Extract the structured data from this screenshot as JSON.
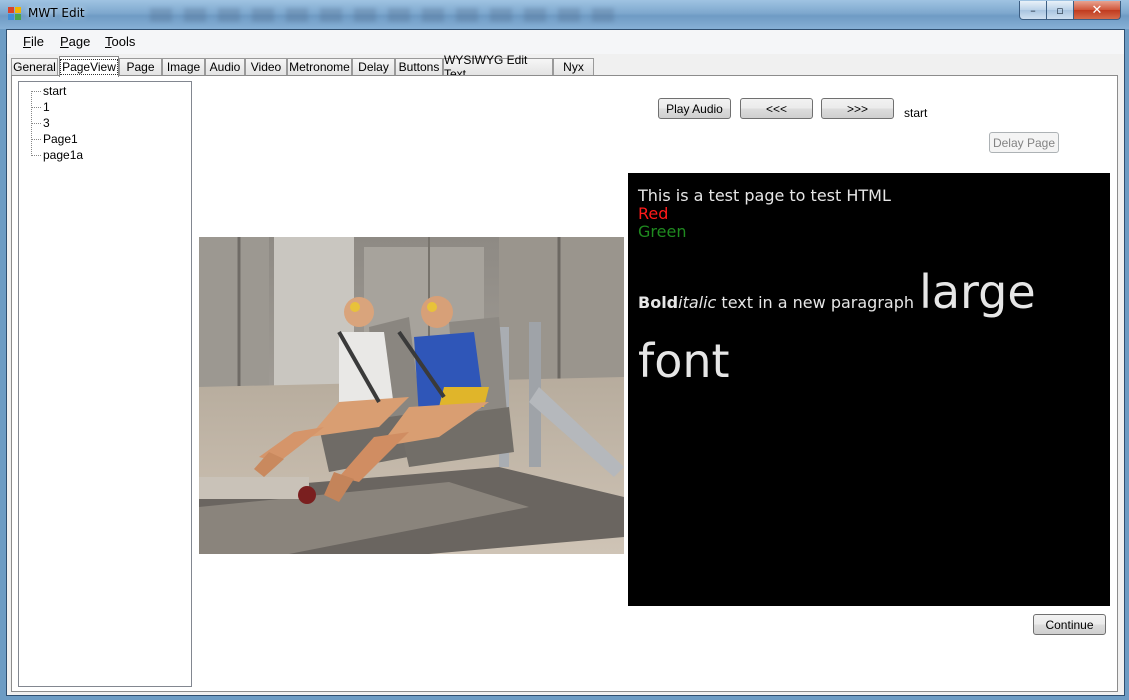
{
  "window": {
    "title": "MWT Edit",
    "buttons": {
      "minimize": "–",
      "maximize": "▫",
      "close": "✕"
    }
  },
  "menu": [
    {
      "label": "File",
      "hotkey": "F",
      "rest": "ile"
    },
    {
      "label": "Page",
      "hotkey": "P",
      "rest": "age"
    },
    {
      "label": "Tools",
      "hotkey": "T",
      "rest": "ools"
    }
  ],
  "tabs": [
    "General",
    "PageView",
    "Page",
    "Image",
    "Audio",
    "Video",
    "Metronome",
    "Delay",
    "Buttons",
    "WYSIWYG Edit Text",
    "Nyx"
  ],
  "active_tab": "PageView",
  "tree": [
    "start",
    "1",
    "3",
    "Page1",
    "page1a"
  ],
  "controls": {
    "play_audio": "Play Audio",
    "prev": "<<<",
    "next": ">>>",
    "current_page": "start",
    "delay_page": "Delay Page",
    "continue": "Continue"
  },
  "html_content": {
    "line1": "This is a test page to test HTML",
    "red": "Red",
    "green": "Green",
    "bold": "Bold",
    "italic": "italic",
    "normal": " text in a new paragraph ",
    "large": "large font"
  },
  "colors": {
    "red_text": "#ff1a1a",
    "green_text": "#1f8a1f",
    "panel_bg": "#000000"
  },
  "image": {
    "name": "crash-test-dummies-photo"
  }
}
